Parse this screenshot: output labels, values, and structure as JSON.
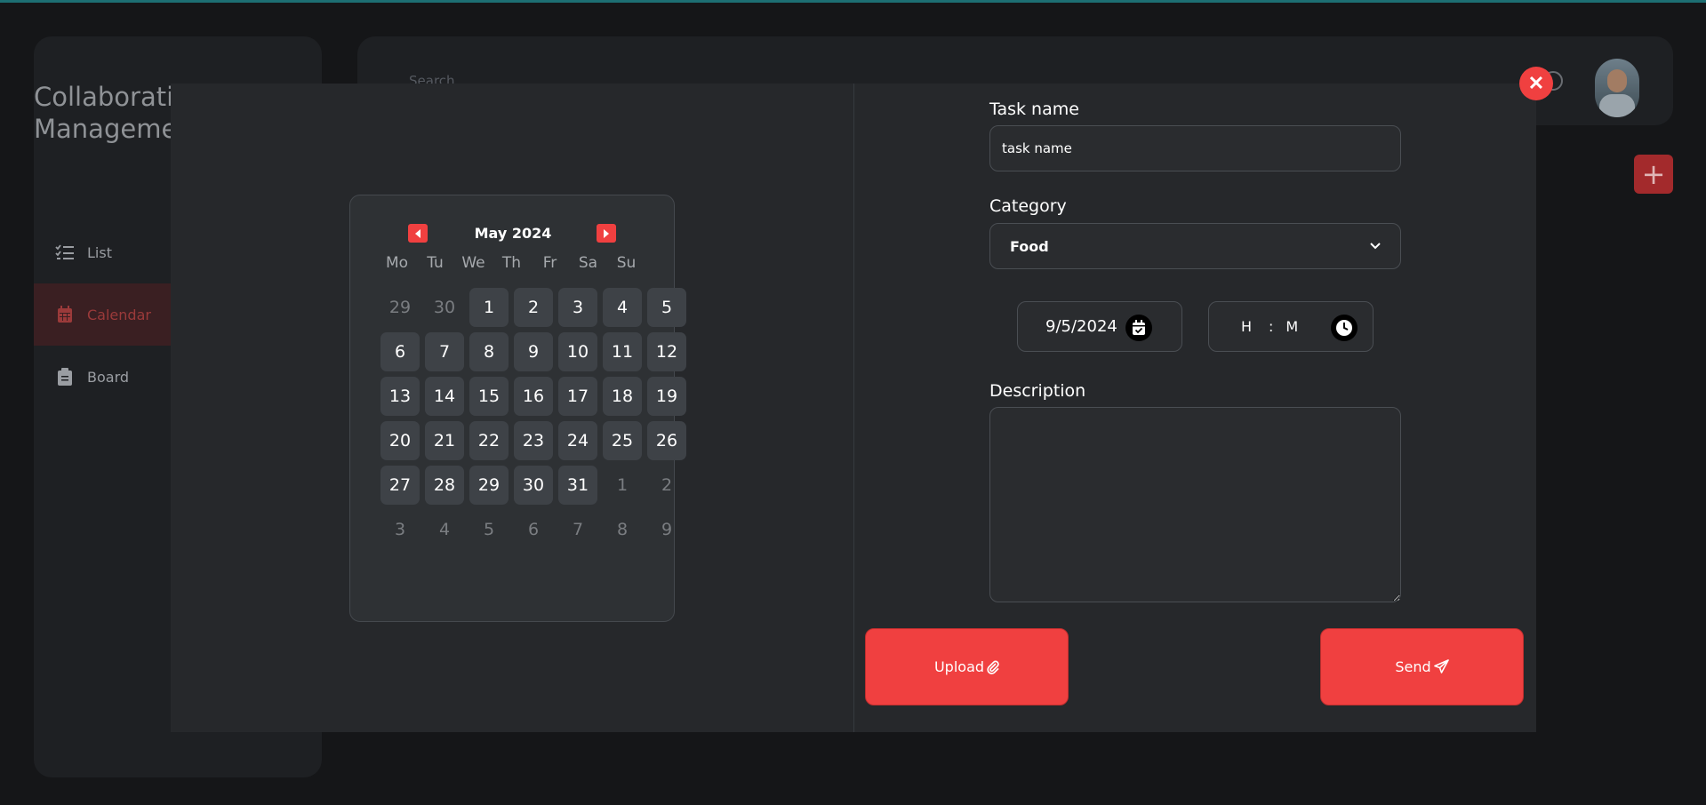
{
  "app": {
    "title": "Collaborative Task\nManagement"
  },
  "sidebar": {
    "items": [
      {
        "label": "List",
        "icon": "list-check-icon"
      },
      {
        "label": "Calendar",
        "icon": "calendar-icon",
        "active": true
      },
      {
        "label": "Board",
        "icon": "clipboard-icon"
      }
    ]
  },
  "header": {
    "search_placeholder": "Search"
  },
  "calendar": {
    "month_label": "May 2024",
    "weekdays": [
      "Mo",
      "Tu",
      "We",
      "Th",
      "Fr",
      "Sa",
      "Su"
    ],
    "days": [
      {
        "n": "29",
        "in": false
      },
      {
        "n": "30",
        "in": false
      },
      {
        "n": "1",
        "in": true
      },
      {
        "n": "2",
        "in": true
      },
      {
        "n": "3",
        "in": true
      },
      {
        "n": "4",
        "in": true
      },
      {
        "n": "5",
        "in": true
      },
      {
        "n": "6",
        "in": true
      },
      {
        "n": "7",
        "in": true
      },
      {
        "n": "8",
        "in": true
      },
      {
        "n": "9",
        "in": true
      },
      {
        "n": "10",
        "in": true
      },
      {
        "n": "11",
        "in": true
      },
      {
        "n": "12",
        "in": true
      },
      {
        "n": "13",
        "in": true
      },
      {
        "n": "14",
        "in": true
      },
      {
        "n": "15",
        "in": true
      },
      {
        "n": "16",
        "in": true
      },
      {
        "n": "17",
        "in": true
      },
      {
        "n": "18",
        "in": true
      },
      {
        "n": "19",
        "in": true
      },
      {
        "n": "20",
        "in": true
      },
      {
        "n": "21",
        "in": true
      },
      {
        "n": "22",
        "in": true
      },
      {
        "n": "23",
        "in": true
      },
      {
        "n": "24",
        "in": true
      },
      {
        "n": "25",
        "in": true
      },
      {
        "n": "26",
        "in": true
      },
      {
        "n": "27",
        "in": true
      },
      {
        "n": "28",
        "in": true
      },
      {
        "n": "29",
        "in": true
      },
      {
        "n": "30",
        "in": true
      },
      {
        "n": "31",
        "in": true
      },
      {
        "n": "1",
        "in": false
      },
      {
        "n": "2",
        "in": false
      },
      {
        "n": "3",
        "in": false
      },
      {
        "n": "4",
        "in": false
      },
      {
        "n": "5",
        "in": false
      },
      {
        "n": "6",
        "in": false
      },
      {
        "n": "7",
        "in": false
      },
      {
        "n": "8",
        "in": false
      },
      {
        "n": "9",
        "in": false
      }
    ]
  },
  "form": {
    "task_name_label": "Task name",
    "task_name_value": "task name",
    "category_label": "Category",
    "category_value": "Food",
    "date_value": "9/5/2024",
    "time_hour_placeholder": "H",
    "time_sep": ":",
    "time_minute_placeholder": "M",
    "description_label": "Description",
    "description_value": "",
    "upload_label": "Upload",
    "send_label": "Send"
  },
  "colors": {
    "accent": "#f04040",
    "modal_bg": "#26282b",
    "page_bg": "#151618"
  }
}
